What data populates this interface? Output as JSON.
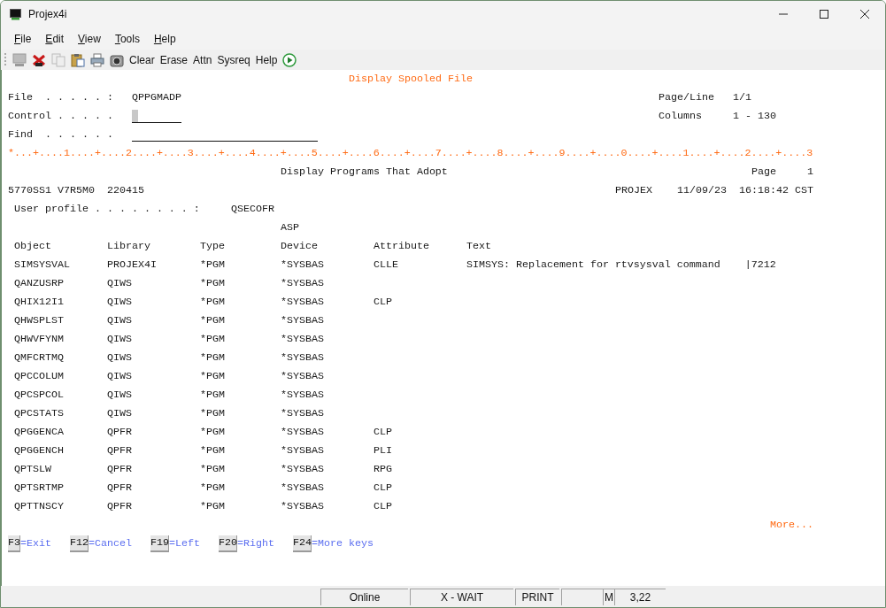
{
  "window": {
    "title": "Projex4i"
  },
  "menu": [
    "File",
    "Edit",
    "View",
    "Tools",
    "Help"
  ],
  "toolbar": {
    "buttons": [
      "Clear",
      "Erase",
      "Attn",
      "Sysreq",
      "Help"
    ]
  },
  "screen": {
    "title": "Display Spooled File",
    "fields": [
      {
        "label": "File  . . . . . :",
        "value": "QPPGMADP",
        "kind": "output"
      },
      {
        "label": "Control . . . . .",
        "kind": "input",
        "cursor": true
      },
      {
        "label": "Find  . . . . . .",
        "kind": "input",
        "cursor": false
      }
    ],
    "info": [
      {
        "label": "Page/Line",
        "value": "1/1"
      },
      {
        "label": "Columns",
        "value": "1 - 130"
      }
    ],
    "ruler": "*...+....1....+....2....+....3....+....4....+....5....+....6....+....7....+....8....+....9....+....0....+....1....+....2....+....3",
    "report": {
      "title": "Display Programs That Adopt",
      "page": "Page     1",
      "product": "5770SS1 V7R5M0  220415",
      "system": "PROJEX",
      "timestamp": "11/09/23  16:18:42 CST",
      "user_profile_label": "User profile . . . . . . . . :",
      "user_profile": "QSECOFR",
      "column_header_top": "ASP",
      "columns": [
        "Object",
        "Library",
        "Type",
        "Device",
        "Attribute",
        "Text"
      ],
      "rows": [
        [
          "SIMSYSVAL",
          "PROJEX4I",
          "*PGM",
          "*SYSBAS",
          "CLLE",
          "SIMSYS: Replacement for rtvsysval command    |7212"
        ],
        [
          "QANZUSRP",
          "QIWS",
          "*PGM",
          "*SYSBAS"
        ],
        [
          "QHIX12I1",
          "QIWS",
          "*PGM",
          "*SYSBAS",
          "CLP"
        ],
        [
          "QHWSPLST",
          "QIWS",
          "*PGM",
          "*SYSBAS"
        ],
        [
          "QHWVFYNM",
          "QIWS",
          "*PGM",
          "*SYSBAS"
        ],
        [
          "QMFCRTMQ",
          "QIWS",
          "*PGM",
          "*SYSBAS"
        ],
        [
          "QPCCOLUM",
          "QIWS",
          "*PGM",
          "*SYSBAS"
        ],
        [
          "QPCSPCOL",
          "QIWS",
          "*PGM",
          "*SYSBAS"
        ],
        [
          "QPCSTATS",
          "QIWS",
          "*PGM",
          "*SYSBAS"
        ],
        [
          "QPGGENCA",
          "QPFR",
          "*PGM",
          "*SYSBAS",
          "CLP"
        ],
        [
          "QPGGENCH",
          "QPFR",
          "*PGM",
          "*SYSBAS",
          "PLI"
        ],
        [
          "QPTSLW",
          "QPFR",
          "*PGM",
          "*SYSBAS",
          "RPG"
        ],
        [
          "QPTSRTMP",
          "QPFR",
          "*PGM",
          "*SYSBAS",
          "CLP"
        ],
        [
          "QPTTNSCY",
          "QPFR",
          "*PGM",
          "*SYSBAS",
          "CLP"
        ]
      ]
    },
    "more": "More...",
    "function_keys": [
      {
        "key": "F3",
        "label": "=Exit"
      },
      {
        "key": "F12",
        "label": "=Cancel"
      },
      {
        "key": "F19",
        "label": "=Left"
      },
      {
        "key": "F20",
        "label": "=Right"
      },
      {
        "key": "F24",
        "label": "=More keys"
      }
    ]
  },
  "status_bar": [
    {
      "text": "Online",
      "kind": "panel"
    },
    {
      "text": "X - WAIT",
      "kind": "panel"
    },
    {
      "text": "PRINT",
      "kind": "panel"
    },
    {
      "kind": "empty"
    },
    {
      "text": "M",
      "kind": "flag"
    },
    {
      "text": "3,22",
      "kind": "panel"
    }
  ]
}
